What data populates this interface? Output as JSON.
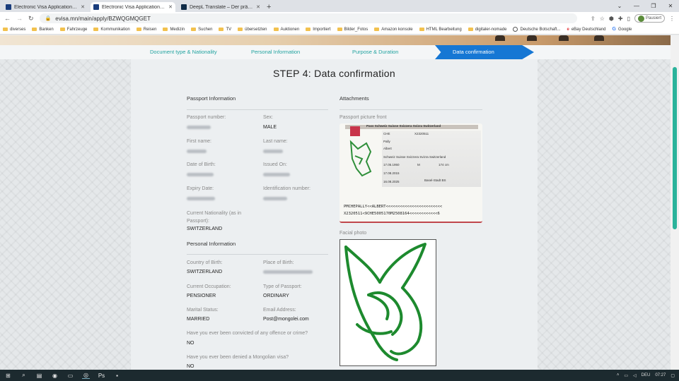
{
  "browser": {
    "tabs": [
      {
        "title": "Electronic Visa Application Syste",
        "active": false
      },
      {
        "title": "Electronic Visa Application Syste",
        "active": true
      },
      {
        "title": "DeepL Translate – Der präziseste",
        "active": false
      }
    ],
    "new_tab": "+",
    "url": "evisa.mn/main/apply/BZWQGMQGET",
    "profile_label": "Pausiert",
    "bookmarks": [
      "diverses",
      "Banken",
      "Fahrzeuge",
      "Kommunikation",
      "Reisen",
      "Medizin",
      "Suchen",
      "TV",
      "übersetzten",
      "Auktionen",
      "Importiert",
      "Bilder_Fotos",
      "Amazon konsole",
      "HTML Bearbeitung",
      "digitaler-nomade",
      "Deutsche Botschaft...",
      "eBay Deutschland",
      "Google"
    ]
  },
  "steps": [
    {
      "label": "Document type & Nationality",
      "active": false
    },
    {
      "label": "Personal Information",
      "active": false
    },
    {
      "label": "Purpose & Duration",
      "active": false
    },
    {
      "label": "Data confirmation",
      "active": true
    }
  ],
  "page_title": "STEP 4: Data confirmation",
  "passport_section": {
    "title": "Passport Information",
    "fields": {
      "passport_number": {
        "label": "Passport number:",
        "value": ""
      },
      "sex": {
        "label": "Sex:",
        "value": "MALE"
      },
      "first_name": {
        "label": "First name:",
        "value": ""
      },
      "last_name": {
        "label": "Last name:",
        "value": ""
      },
      "dob": {
        "label": "Date of Birth:",
        "value": ""
      },
      "issued_on": {
        "label": "Issued On:",
        "value": ""
      },
      "expiry": {
        "label": "Expiry Date:",
        "value": ""
      },
      "id_number": {
        "label": "Identification number:",
        "value": ""
      },
      "nationality": {
        "label": "Current Nationality (as in Passport):",
        "value": "SWITZERLAND"
      }
    }
  },
  "personal_section": {
    "title": "Personal Information",
    "fields": {
      "country_birth": {
        "label": "Country of Birth:",
        "value": "SWITZERLAND"
      },
      "place_birth": {
        "label": "Place of Birth:",
        "value": ""
      },
      "occupation": {
        "label": "Current Occupation:",
        "value": "PENSIONER"
      },
      "passport_type": {
        "label": "Type of Passport:",
        "value": "ORDINARY"
      },
      "marital": {
        "label": "Marital Status:",
        "value": "MARRIED"
      },
      "email": {
        "label": "Email Address:",
        "value": "Post@mongolei.com"
      },
      "crime": {
        "label": "Have you ever been convicted of any offence or crime?",
        "value": "NO"
      },
      "denied": {
        "label": "Have you ever been denied a Mongolian visa?",
        "value": "NO"
      }
    }
  },
  "attachments": {
    "title": "Attachments",
    "passport_label": "Passport picture front",
    "facial_label": "Facial photo",
    "passport_text": {
      "header": "Pass Schweiz Suisse Svizzera Svizra Switzerland",
      "number": "X2320511",
      "code": "CHE",
      "surname": "Pally",
      "given": "Albert",
      "nationality": "Schweiz Suisse Svizzera Svizra Switzerland",
      "dob": "17.05.1950",
      "height": "174 cm",
      "sex": "M",
      "authority": "Basel-Stadt BS",
      "issued": "17.08.2015",
      "expiry": "16.08.2025",
      "mrz1": "PMCHEPALLY<<ALBERT<<<<<<<<<<<<<<<<<<<<<<<<",
      "mrz2": "X2320511<9CHE5005170M2508164<<<<<<<<<<<<6"
    }
  },
  "taskbar": {
    "lang": "DEU",
    "time": "07:27"
  },
  "colors": {
    "step_active": "#1677d4",
    "step_text": "#22a3a0",
    "scroll_accent": "#2bb39b"
  }
}
